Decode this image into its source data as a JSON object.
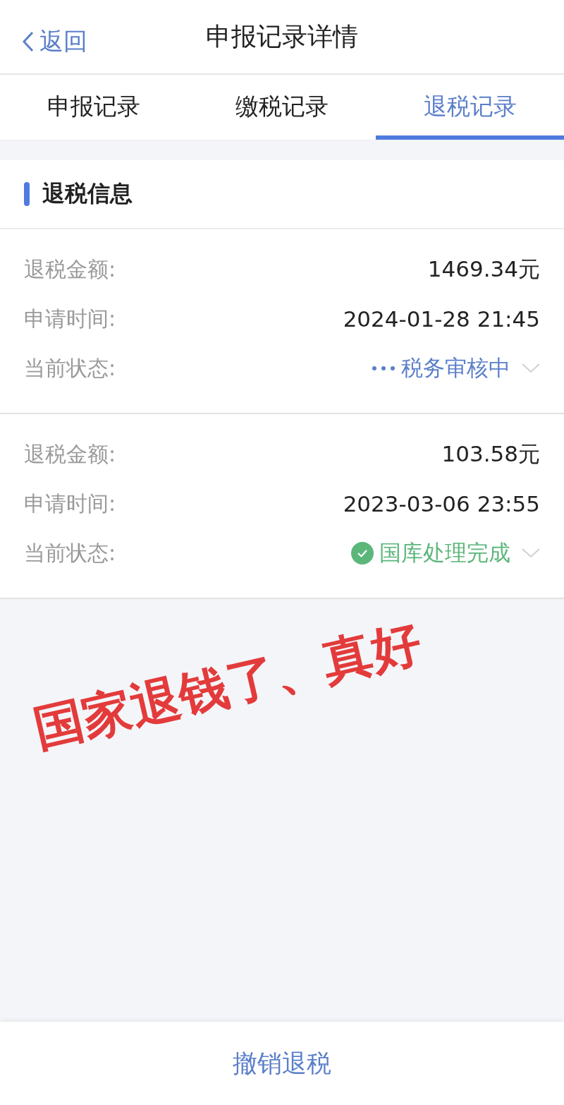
{
  "nav": {
    "back": "返回",
    "title": "申报记录详情"
  },
  "tabs": [
    {
      "label": "申报记录",
      "selected": false
    },
    {
      "label": "缴税记录",
      "selected": false
    },
    {
      "label": "退税记录",
      "selected": true
    }
  ],
  "section": {
    "title": "退税信息"
  },
  "records": [
    {
      "fields": [
        {
          "label": "退税金额:",
          "value": "1469.34元"
        },
        {
          "label": "申请时间:",
          "value": "2024-01-28 21:45"
        }
      ],
      "status_label": "当前状态:",
      "status": {
        "kind": "pending",
        "text": "税务审核中"
      }
    },
    {
      "fields": [
        {
          "label": "退税金额:",
          "value": "103.58元"
        },
        {
          "label": "申请时间:",
          "value": "2023-03-06 23:55"
        }
      ],
      "status_label": "当前状态:",
      "status": {
        "kind": "done",
        "text": "国库处理完成"
      }
    }
  ],
  "annotation": {
    "text": "国家退钱了、真好"
  },
  "bottom_button": "撤销退税"
}
